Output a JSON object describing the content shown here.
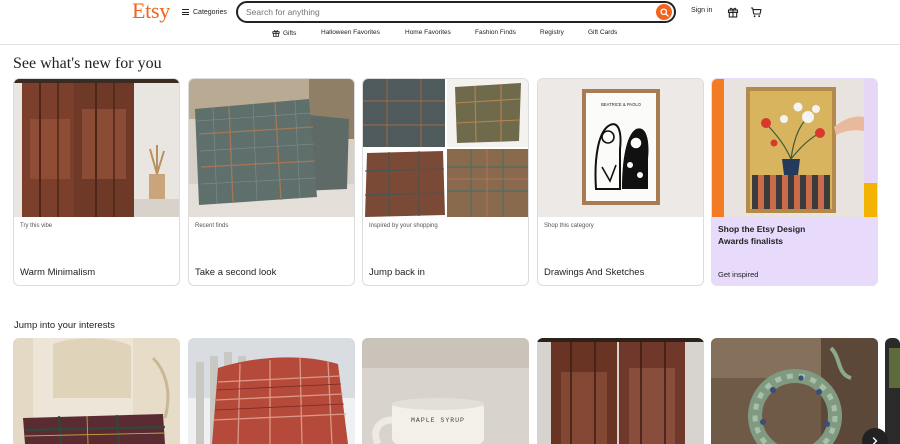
{
  "header": {
    "logo": "Etsy",
    "categories_label": "Categories",
    "search_placeholder": "Search for anything",
    "signin_label": "Sign in",
    "colors": {
      "brand": "#f1641e"
    }
  },
  "subnav": [
    {
      "label": "Gifts",
      "icon": "gift-icon"
    },
    {
      "label": "Halloween Favorites"
    },
    {
      "label": "Home Favorites"
    },
    {
      "label": "Fashion Finds"
    },
    {
      "label": "Registry"
    },
    {
      "label": "Gift Cards"
    }
  ],
  "section1": {
    "title": "See what's new for you",
    "cards": [
      {
        "kicker": "Try this vibe",
        "title": "Warm Minimalism"
      },
      {
        "kicker": "Recent finds",
        "title": "Take a second look"
      },
      {
        "kicker": "Inspired by your shopping",
        "title": "Jump back in"
      },
      {
        "kicker": "Shop this category",
        "title": "Drawings And Sketches"
      },
      {
        "title": "Shop the Etsy Design Awards finalists",
        "cta": "Get inspired"
      }
    ],
    "artwork_text": "BEATRICE & PAOLO"
  },
  "section2": {
    "title": "Jump into your interests",
    "mug_text": "MAPLE SYRUP"
  }
}
